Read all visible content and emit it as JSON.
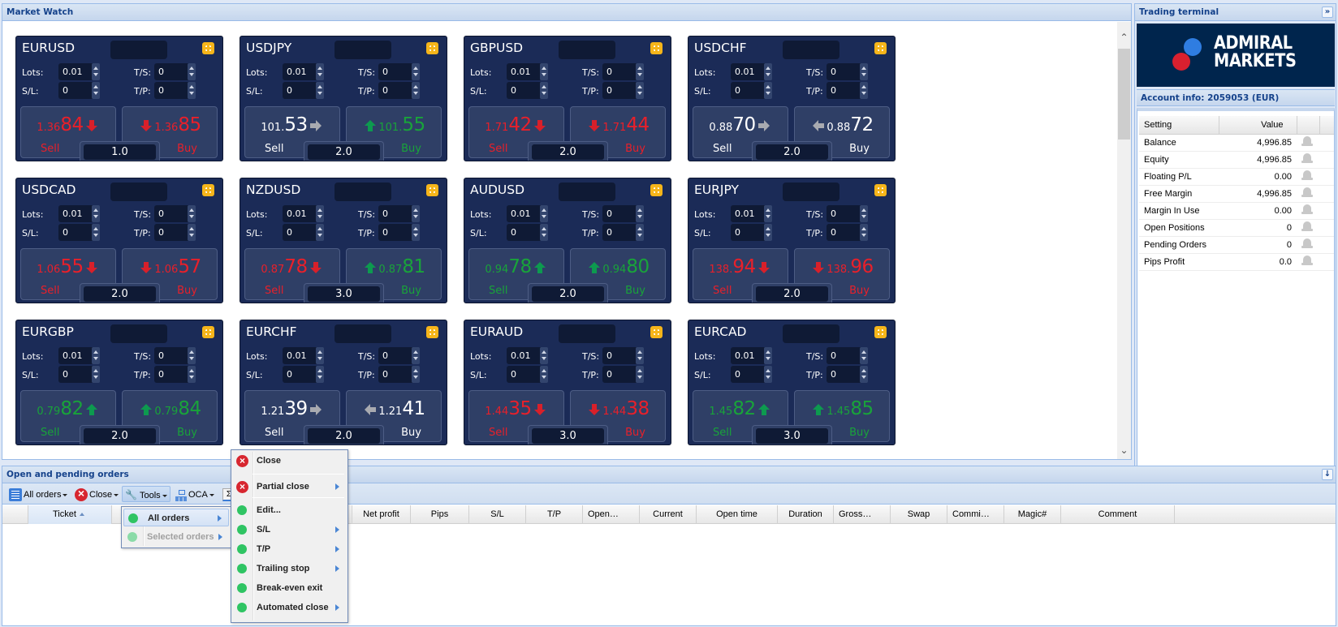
{
  "market_watch": {
    "title": "Market Watch",
    "field_labels": {
      "lots": "Lots:",
      "sl": "S/L:",
      "ts": "T/S:",
      "tp": "T/P:"
    },
    "side_labels": {
      "sell": "Sell",
      "buy": "Buy"
    },
    "colors": {
      "red": "#e8202a",
      "green": "#19a33a",
      "neutral": "#ffffff",
      "tile_bg": "#1b2b57",
      "expand_icon": "#f6b51a"
    },
    "tiles": [
      {
        "symbol": "EURUSD",
        "lots": "0.01",
        "sl": "0",
        "ts": "0",
        "tp": "0",
        "sell": {
          "small": "1.36",
          "big": "84",
          "trend": "down"
        },
        "buy": {
          "small": "1.36",
          "big": "85",
          "trend": "down"
        },
        "quantity": "1.0",
        "sell_label_color": "red",
        "buy_label_color": "red"
      },
      {
        "symbol": "USDJPY",
        "lots": "0.01",
        "sl": "0",
        "ts": "0",
        "tp": "0",
        "sell": {
          "small": "101.",
          "big": "53",
          "trend": "flat"
        },
        "buy": {
          "small": "101.",
          "big": "55",
          "trend": "up"
        },
        "quantity": "2.0",
        "sell_label_color": "neutral",
        "buy_label_color": "green"
      },
      {
        "symbol": "GBPUSD",
        "lots": "0.01",
        "sl": "0",
        "ts": "0",
        "tp": "0",
        "sell": {
          "small": "1.71",
          "big": "42",
          "trend": "down"
        },
        "buy": {
          "small": "1.71",
          "big": "44",
          "trend": "down"
        },
        "quantity": "2.0",
        "sell_label_color": "red",
        "buy_label_color": "red"
      },
      {
        "symbol": "USDCHF",
        "lots": "0.01",
        "sl": "0",
        "ts": "0",
        "tp": "0",
        "sell": {
          "small": "0.88",
          "big": "70",
          "trend": "flat"
        },
        "buy": {
          "small": "0.88",
          "big": "72",
          "trend": "flat"
        },
        "quantity": "2.0",
        "sell_label_color": "neutral",
        "buy_label_color": "neutral"
      },
      {
        "symbol": "USDCAD",
        "lots": "0.01",
        "sl": "0",
        "ts": "0",
        "tp": "0",
        "sell": {
          "small": "1.06",
          "big": "55",
          "trend": "down"
        },
        "buy": {
          "small": "1.06",
          "big": "57",
          "trend": "down"
        },
        "quantity": "2.0",
        "sell_label_color": "red",
        "buy_label_color": "red"
      },
      {
        "symbol": "NZDUSD",
        "lots": "0.01",
        "sl": "0",
        "ts": "0",
        "tp": "0",
        "sell": {
          "small": "0.87",
          "big": "78",
          "trend": "down"
        },
        "buy": {
          "small": "0.87",
          "big": "81",
          "trend": "up"
        },
        "quantity": "3.0",
        "sell_label_color": "red",
        "buy_label_color": "green"
      },
      {
        "symbol": "AUDUSD",
        "lots": "0.01",
        "sl": "0",
        "ts": "0",
        "tp": "0",
        "sell": {
          "small": "0.94",
          "big": "78",
          "trend": "up"
        },
        "buy": {
          "small": "0.94",
          "big": "80",
          "trend": "up"
        },
        "quantity": "2.0",
        "sell_label_color": "green",
        "buy_label_color": "green"
      },
      {
        "symbol": "EURJPY",
        "lots": "0.01",
        "sl": "0",
        "ts": "0",
        "tp": "0",
        "sell": {
          "small": "138.",
          "big": "94",
          "trend": "down"
        },
        "buy": {
          "small": "138.",
          "big": "96",
          "trend": "down"
        },
        "quantity": "2.0",
        "sell_label_color": "red",
        "buy_label_color": "red"
      },
      {
        "symbol": "EURGBP",
        "lots": "0.01",
        "sl": "0",
        "ts": "0",
        "tp": "0",
        "sell": {
          "small": "0.79",
          "big": "82",
          "trend": "up"
        },
        "buy": {
          "small": "0.79",
          "big": "84",
          "trend": "up"
        },
        "quantity": "2.0",
        "sell_label_color": "green",
        "buy_label_color": "green"
      },
      {
        "symbol": "EURCHF",
        "lots": "0.01",
        "sl": "0",
        "ts": "0",
        "tp": "0",
        "sell": {
          "small": "1.21",
          "big": "39",
          "trend": "flat"
        },
        "buy": {
          "small": "1.21",
          "big": "41",
          "trend": "flat"
        },
        "quantity": "2.0",
        "sell_label_color": "neutral",
        "buy_label_color": "neutral"
      },
      {
        "symbol": "EURAUD",
        "lots": "0.01",
        "sl": "0",
        "ts": "0",
        "tp": "0",
        "sell": {
          "small": "1.44",
          "big": "35",
          "trend": "down"
        },
        "buy": {
          "small": "1.44",
          "big": "38",
          "trend": "down"
        },
        "quantity": "3.0",
        "sell_label_color": "red",
        "buy_label_color": "red"
      },
      {
        "symbol": "EURCAD",
        "lots": "0.01",
        "sl": "0",
        "ts": "0",
        "tp": "0",
        "sell": {
          "small": "1.45",
          "big": "82",
          "trend": "up"
        },
        "buy": {
          "small": "1.45",
          "big": "85",
          "trend": "up"
        },
        "quantity": "3.0",
        "sell_label_color": "green",
        "buy_label_color": "green"
      }
    ]
  },
  "trading_terminal": {
    "title": "Trading terminal",
    "collapse_icon": "double-chevron-right-icon",
    "logo": {
      "line1": "ADMIRAL",
      "line2": "MARKETS",
      "dot_blue": "#2f7de1",
      "dot_red": "#d9202f",
      "bg": "#00254d"
    },
    "account_info_title": "Account info: 2059053 (EUR)",
    "columns": [
      "Setting",
      "Value"
    ],
    "rows": [
      {
        "setting": "Balance",
        "value": "4,996.85"
      },
      {
        "setting": "Equity",
        "value": "4,996.85"
      },
      {
        "setting": "Floating P/L",
        "value": "0.00"
      },
      {
        "setting": "Free Margin",
        "value": "4,996.85"
      },
      {
        "setting": "Margin In Use",
        "value": "0.00"
      },
      {
        "setting": "Open Positions",
        "value": "0"
      },
      {
        "setting": "Pending Orders",
        "value": "0"
      },
      {
        "setting": "Pips Profit",
        "value": "0.0"
      }
    ]
  },
  "orders_panel": {
    "title": "Open and pending orders",
    "collapse_icon": "double-chevron-down-icon",
    "toolbar": {
      "all_orders": "All orders",
      "close": "Close",
      "tools": "Tools",
      "oca": "OCA",
      "sigma": "Σ"
    },
    "columns": [
      "Ticket",
      "Net profit",
      "Pips",
      "S/L",
      "T/P",
      "Open…",
      "Current",
      "Open time",
      "Duration",
      "Gross…",
      "Swap",
      "Commi…",
      "Magic#",
      "Comment"
    ],
    "sorted_column": "Ticket"
  },
  "tools_menu": {
    "items": [
      {
        "label": "All orders",
        "active": true,
        "disabled": false,
        "submenu": true
      },
      {
        "label": "Selected orders",
        "active": false,
        "disabled": true,
        "submenu": true
      }
    ]
  },
  "context_menu": {
    "items": [
      {
        "label": "Close",
        "icon": "close-red-icon",
        "submenu": false
      },
      {
        "label": "Partial close",
        "icon": "close-red-icon",
        "submenu": true
      },
      {
        "label": "Edit...",
        "icon": "green-dot-icon",
        "submenu": false
      },
      {
        "label": "S/L",
        "icon": "green-dot-icon",
        "submenu": true
      },
      {
        "label": "T/P",
        "icon": "green-dot-icon",
        "submenu": true
      },
      {
        "label": "Trailing stop",
        "icon": "green-dot-icon",
        "submenu": true
      },
      {
        "label": "Break-even exit",
        "icon": "green-dot-icon",
        "submenu": false
      },
      {
        "label": "Automated close",
        "icon": "green-dot-icon",
        "submenu": true
      }
    ]
  }
}
